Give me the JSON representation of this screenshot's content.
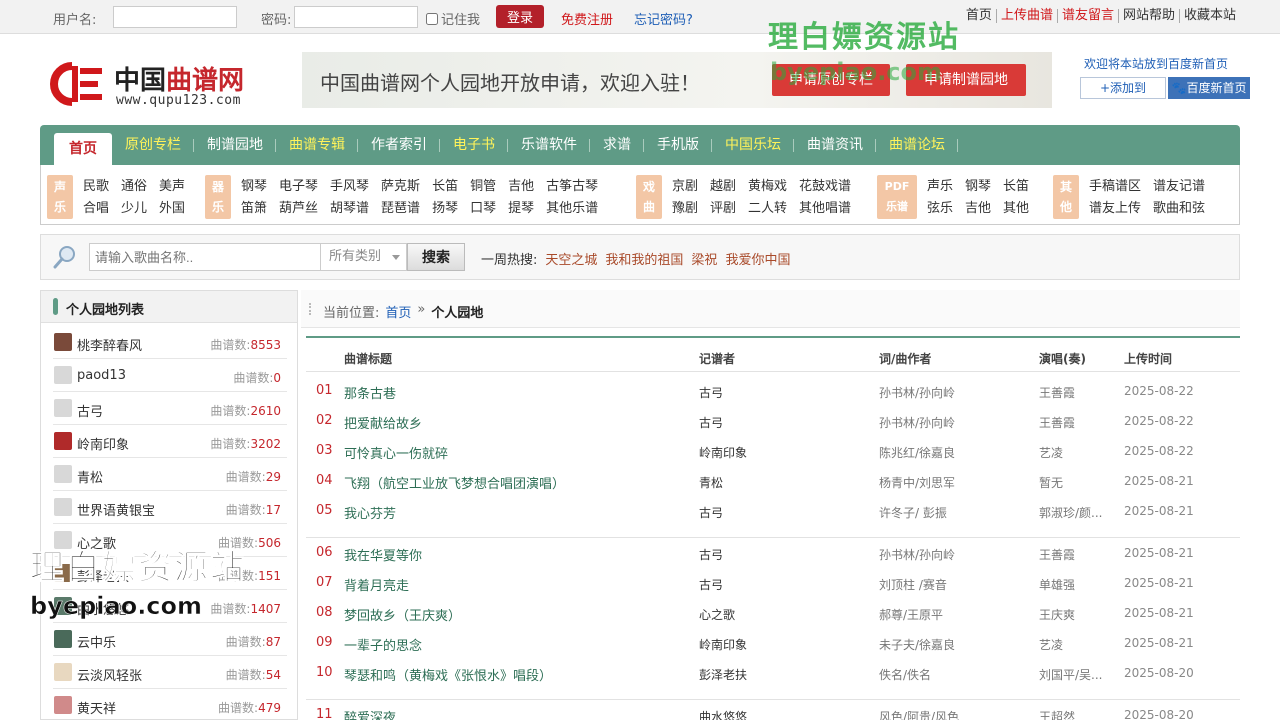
{
  "topbar": {
    "username_label": "用户名:",
    "password_label": "密码:",
    "remember_label": "记住我",
    "login_button": "登录",
    "register_link": "免费注册",
    "forgot_link": "忘记密码?",
    "links": [
      "首页",
      "上传曲谱",
      "谱友留言",
      "网站帮助",
      "收藏本站"
    ]
  },
  "header": {
    "logo_cn_1": "中国",
    "logo_cn_2": "曲谱网",
    "logo_url": "www.qupu123.com",
    "banner_text": "中国曲谱网个人园地开放申请，欢迎入驻！",
    "banner_btn_1": "申请原创专栏",
    "banner_btn_2": "申请制谱园地",
    "fav_text": "欢迎将本站放到百度新首页",
    "fav_add": "+添加到",
    "fav_baidu": "百度新首页"
  },
  "nav": [
    "首页",
    "原创专栏",
    "制谱园地",
    "曲谱专辑",
    "作者索引",
    "电子书",
    "乐谱软件",
    "求谱",
    "手机版",
    "中国乐坛",
    "曲谱资讯",
    "曲谱论坛"
  ],
  "categories": [
    {
      "badge": [
        "声",
        "乐"
      ],
      "links": [
        "民歌",
        "合唱",
        "通俗",
        "少儿",
        "美声",
        "外国"
      ]
    },
    {
      "badge": [
        "器",
        "乐"
      ],
      "links": [
        "钢琴",
        "笛箫",
        "电子琴",
        "葫芦丝",
        "手风琴",
        "胡琴谱",
        "萨克斯",
        "琵琶谱",
        "长笛",
        "扬琴",
        "铜管",
        "口琴",
        "吉他",
        "提琴",
        "古筝古琴",
        "其他乐谱"
      ]
    },
    {
      "badge": [
        "戏",
        "曲"
      ],
      "links": [
        "京剧",
        "豫剧",
        "越剧",
        "评剧",
        "黄梅戏",
        "二人转",
        "花鼓戏谱",
        "其他唱谱"
      ]
    },
    {
      "badge": [
        "PDF",
        "乐谱"
      ],
      "links": [
        "声乐",
        "弦乐",
        "钢琴",
        "吉他",
        "长笛",
        "其他"
      ]
    },
    {
      "badge": [
        "其",
        "他"
      ],
      "links": [
        "手稿谱区",
        "谱友上传",
        "谱友记谱",
        "歌曲和弦"
      ]
    }
  ],
  "search": {
    "placeholder": "请输入歌曲名称..",
    "category": "所有类别",
    "button": "搜索",
    "hot_label": "一周热搜:",
    "hot": [
      "天空之城",
      "我和我的祖国",
      "梁祝",
      "我爱你中国"
    ]
  },
  "sidebar": {
    "title": "个人园地列表",
    "count_label": "曲谱数:",
    "items": [
      {
        "name": "桃李醉春风",
        "count": "8553",
        "color": "#7a4a3a"
      },
      {
        "name": "paod13",
        "count": "0",
        "color": "#d8d8d8"
      },
      {
        "name": "古弓",
        "count": "2610",
        "color": "#d8d8d8"
      },
      {
        "name": "岭南印象",
        "count": "3202",
        "color": "#b02a2a"
      },
      {
        "name": "青松",
        "count": "29",
        "color": "#d8d8d8"
      },
      {
        "name": "世界语黄银宝",
        "count": "17",
        "color": "#d8d8d8"
      },
      {
        "name": "心之歌",
        "count": "506",
        "color": "#d8d8d8"
      },
      {
        "name": "彭泽老扶",
        "count": "151",
        "color": "#8a6a4a"
      },
      {
        "name": "曲水悠悠",
        "count": "1407",
        "color": "#5a7a6a"
      },
      {
        "name": "云中乐",
        "count": "87",
        "color": "#4a6a5a"
      },
      {
        "name": "云淡风轻张",
        "count": "54",
        "color": "#e8d8c0"
      },
      {
        "name": "黄天祥",
        "count": "479",
        "color": "#d08a8a"
      }
    ]
  },
  "breadcrumb": {
    "label": "当前位置:",
    "home": "首页",
    "sep": "»",
    "current": "个人园地"
  },
  "table": {
    "headers": [
      "曲谱标题",
      "记谱者",
      "词/曲作者",
      "演唱(奏)",
      "上传时间"
    ],
    "rows": [
      {
        "no": "01",
        "title": "那条古巷",
        "recorder": "古弓",
        "composer": "孙书林/孙向岭",
        "performer": "王善霞",
        "date": "2025-08-22"
      },
      {
        "no": "02",
        "title": "把爱献给故乡",
        "recorder": "古弓",
        "composer": "孙书林/孙向岭",
        "performer": "王善霞",
        "date": "2025-08-22"
      },
      {
        "no": "03",
        "title": "可怜真心一伤就碎",
        "recorder": "岭南印象",
        "composer": "陈兆红/徐嘉良",
        "performer": "艺凌",
        "date": "2025-08-22"
      },
      {
        "no": "04",
        "title": "飞翔（航空工业放飞梦想合唱团演唱）",
        "recorder": "青松",
        "composer": "杨青中/刘思军",
        "performer": "暂无",
        "date": "2025-08-21"
      },
      {
        "no": "05",
        "title": "我心芬芳",
        "recorder": "古弓",
        "composer": "许冬子/ 彭振",
        "performer": "郭淑珍/颜...",
        "date": "2025-08-21"
      },
      {
        "no": "06",
        "title": "我在华夏等你",
        "recorder": "古弓",
        "composer": "孙书林/孙向岭",
        "performer": "王善霞",
        "date": "2025-08-21"
      },
      {
        "no": "07",
        "title": "背着月亮走",
        "recorder": "古弓",
        "composer": "刘顶柱 /赛音",
        "performer": "单雄强",
        "date": "2025-08-21"
      },
      {
        "no": "08",
        "title": "梦回故乡（王庆爽）",
        "recorder": "心之歌",
        "composer": "郝尊/王原平",
        "performer": "王庆爽",
        "date": "2025-08-21"
      },
      {
        "no": "09",
        "title": "一辈子的思念",
        "recorder": "岭南印象",
        "composer": "未子夫/徐嘉良",
        "performer": "艺凌",
        "date": "2025-08-21"
      },
      {
        "no": "10",
        "title": "琴瑟和鸣（黄梅戏《张恨水》唱段）",
        "recorder": "彭泽老扶",
        "composer": "佚名/佚名",
        "performer": "刘国平/吴...",
        "date": "2025-08-20"
      },
      {
        "no": "11",
        "title": "醉爱深夜",
        "recorder": "曲水悠悠",
        "composer": "风色/阿贵/风色",
        "performer": "王超然",
        "date": "2025-08-20"
      }
    ]
  },
  "watermark": {
    "text": "理白嫖资源站",
    "url": "byepiao.com"
  }
}
